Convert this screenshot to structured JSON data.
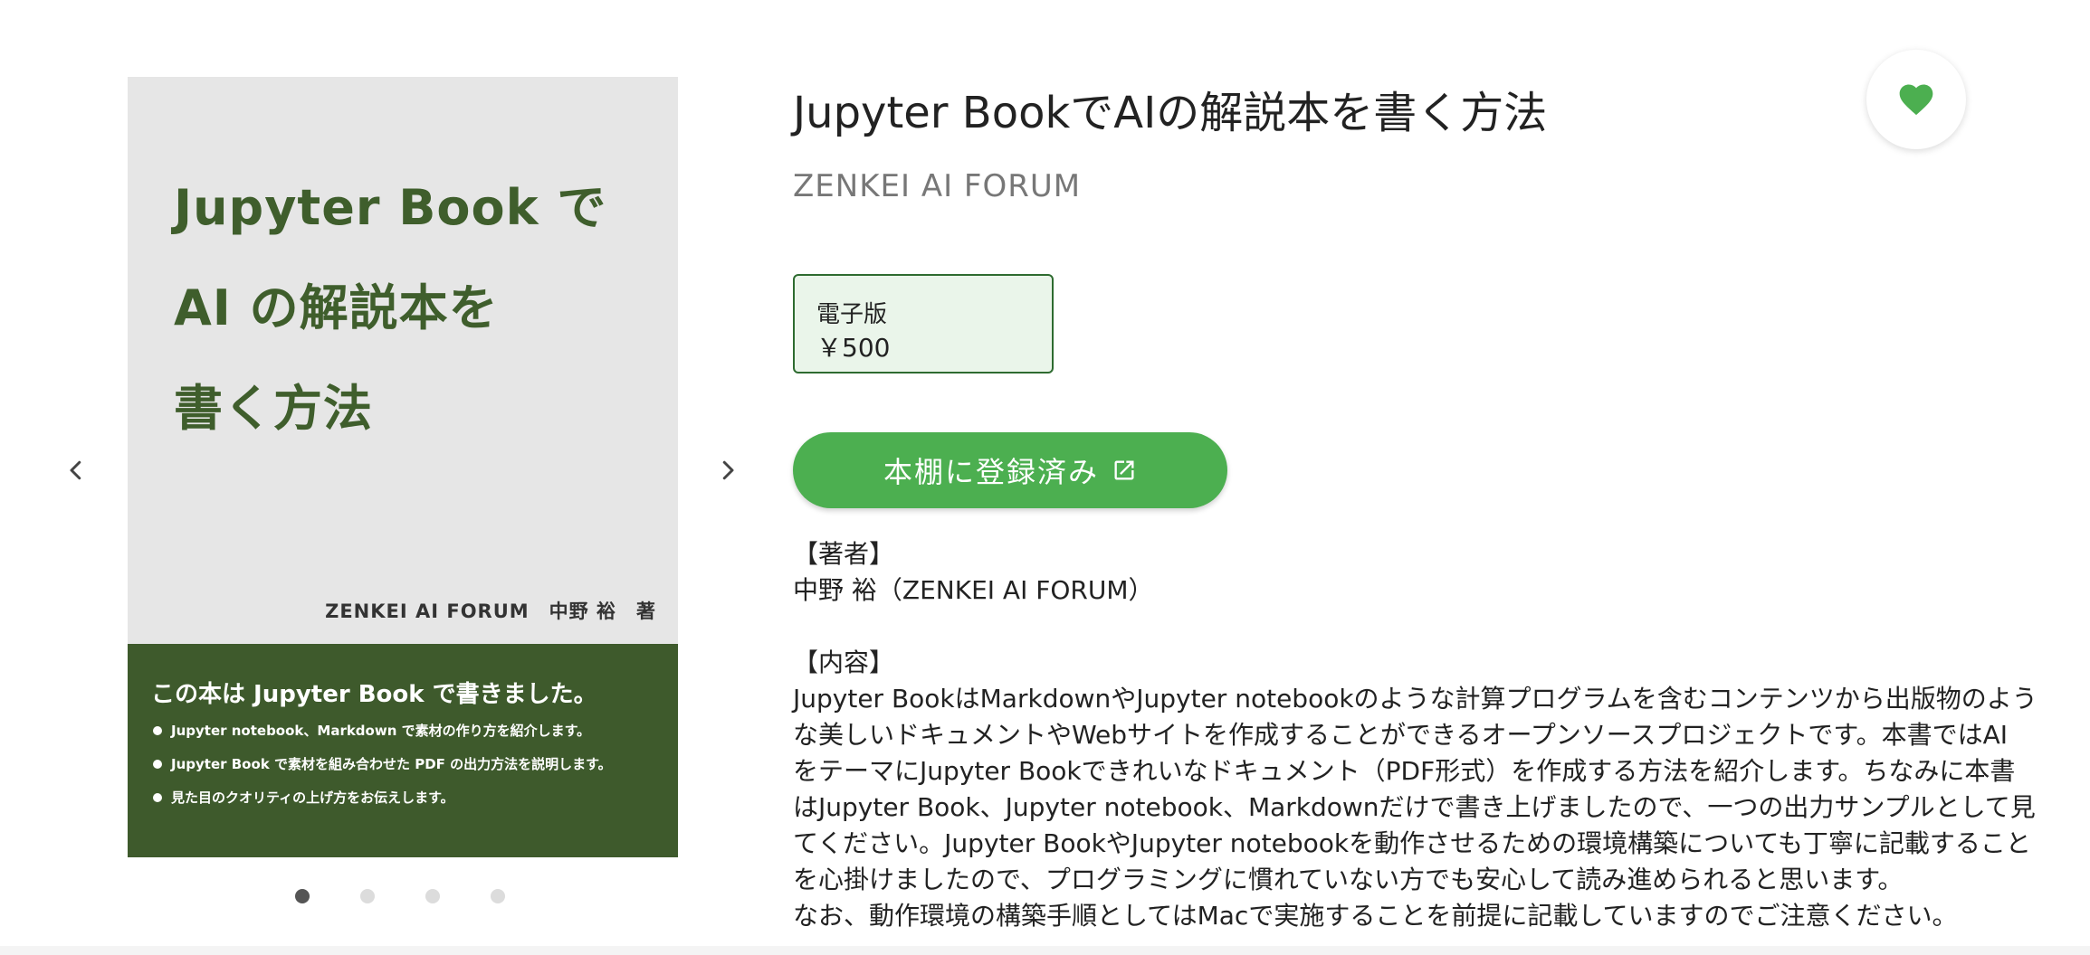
{
  "carousel": {
    "prev_icon": "chevron-left-icon",
    "next_icon": "chevron-right-icon",
    "dots_count": 4,
    "active_dot": 1
  },
  "cover": {
    "title_lines": [
      "Jupyter Book で",
      "AI の解説本を",
      "書く方法"
    ],
    "author": "ZENKEI AI FORUM　中野 裕　著",
    "headline": "この本は Jupyter Book で書きました。",
    "bullets": [
      "Jupyter notebook、Markdown で素材の作り方を紹介します。",
      "Jupyter Book で素材を組み合わせた PDF の出力方法を説明します。",
      "見た目のクオリティの上げ方をお伝えします。"
    ],
    "colors": {
      "title": "#3f5e2c",
      "band": "#3e5a2c",
      "background": "#e6e6e6"
    }
  },
  "book": {
    "title": "Jupyter BookでAIの解説本を書く方法",
    "publisher": "ZENKEI AI FORUM",
    "favorite_icon": "heart-icon",
    "favorite_color": "#4caf50"
  },
  "purchase": {
    "edition": "電子版",
    "price": "￥500",
    "shelf_button": "本棚に登録済み",
    "shelf_icon": "external-link-icon",
    "accent": "#4caf50"
  },
  "description": {
    "author_heading": "【著者】",
    "author": "中野 裕（ZENKEI AI FORUM）",
    "content_heading": "【内容】",
    "lines": [
      "Jupyter BookはMarkdownやJupyter notebookのような計算プログラムを含むコンテンツから出版物のよう",
      "な美しいドキュメントやWebサイトを作成することができるオープンソースプロジェクトです。本書ではAI",
      "をテーマにJupyter Bookできれいなドキュメント（PDF形式）を作成する方法を紹介します。ちなみに本書",
      "はJupyter Book、Jupyter notebook、Markdownだけで書き上げましたので、一つの出力サンプルとして見",
      "てください。Jupyter BookやJupyter notebookを動作させるための環境構築についても丁寧に記載すること",
      "を心掛けましたので、プログラミングに慣れていない方でも安心して読み進められると思います。",
      "なお、動作環境の構築手順としてはMacで実施することを前提に記載していますのでご注意ください。"
    ]
  }
}
